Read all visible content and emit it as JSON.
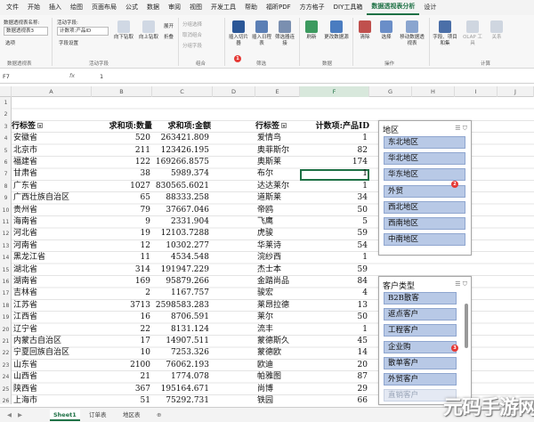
{
  "menubar": {
    "items": [
      "文件",
      "开始",
      "插入",
      "绘图",
      "页面布局",
      "公式",
      "数据",
      "审阅",
      "视图",
      "开发工具",
      "帮助",
      "福昕PDF",
      "方方格子",
      "DIY工具箱",
      "数据透视表分析",
      "设计"
    ],
    "active_index": 14
  },
  "ribbon": {
    "pivot_name_label": "数据透视表名称:",
    "pivot_name": "数据透视表3",
    "options_label": "选项",
    "active_field_label": "活动字段:",
    "active_field": "计数项:产品ID",
    "field_settings": "字段设置",
    "drill_down": "向下钻取",
    "drill_up": "向上钻取",
    "expand": "展开",
    "collapse": "折叠",
    "group_selection": "分组选择",
    "ungroup": "取消组合",
    "group_field": "分组字段",
    "insert_slicer": "插入切片器",
    "insert_timeline": "插入日程表",
    "filter_connections": "筛选器连接",
    "refresh": "刷新",
    "change_source": "更改数据源",
    "clear": "清除",
    "select": "选择",
    "move_pivot": "移动数据透视表",
    "fields_items_sets": "字段、项目和集",
    "olap_tools": "OLAP 工具",
    "relationships": "关系",
    "groups": {
      "pivot": "数据透视表",
      "active_field": "活动字段",
      "combine": "组合",
      "filter": "筛选",
      "data": "数据",
      "actions": "操作",
      "calc": "计算"
    }
  },
  "formula_bar": {
    "name_box": "F7",
    "fx": "fx",
    "value": "1"
  },
  "columns": [
    "A",
    "B",
    "C",
    "D",
    "E",
    "F",
    "G",
    "H",
    "I",
    "J"
  ],
  "selected_column": "F",
  "rows": [
    "1",
    "2",
    "3",
    "4",
    "5",
    "6",
    "7",
    "8",
    "9",
    "10",
    "11",
    "12",
    "13",
    "14",
    "15",
    "16",
    "17",
    "18",
    "19",
    "20",
    "21",
    "22",
    "23",
    "24",
    "25",
    "26",
    "27"
  ],
  "left_table": {
    "headers": [
      "行标签",
      "求和项:数量",
      "求和项:金额"
    ],
    "rows": [
      [
        "安徽省",
        "520",
        "263421.809"
      ],
      [
        "北京市",
        "211",
        "123426.195"
      ],
      [
        "福建省",
        "122",
        "169266.8575"
      ],
      [
        "甘肃省",
        "38",
        "5989.374"
      ],
      [
        "广东省",
        "1027",
        "830565.6021"
      ],
      [
        "广西壮族自治区",
        "65",
        "88333.258"
      ],
      [
        "贵州省",
        "79",
        "37667.046"
      ],
      [
        "海南省",
        "9",
        "2331.904"
      ],
      [
        "河北省",
        "19",
        "12103.7288"
      ],
      [
        "河南省",
        "12",
        "10302.277"
      ],
      [
        "黑龙江省",
        "11",
        "4534.548"
      ],
      [
        "湖北省",
        "314",
        "191947.229"
      ],
      [
        "湖南省",
        "169",
        "95879.266"
      ],
      [
        "吉林省",
        "2",
        "1167.757"
      ],
      [
        "江苏省",
        "3713",
        "2598583.283"
      ],
      [
        "江西省",
        "16",
        "8706.591"
      ],
      [
        "辽宁省",
        "22",
        "8131.124"
      ],
      [
        "内蒙古自治区",
        "17",
        "14907.511"
      ],
      [
        "宁夏回族自治区",
        "10",
        "7253.326"
      ],
      [
        "山东省",
        "2100",
        "76062.193"
      ],
      [
        "山西省",
        "21",
        "1774.078"
      ],
      [
        "陕西省",
        "367",
        "195164.671"
      ],
      [
        "上海市",
        "51",
        "75292.731"
      ]
    ]
  },
  "right_table": {
    "headers": [
      "行标签",
      "计数项:产品ID"
    ],
    "rows": [
      [
        "爱情鸟",
        "1"
      ],
      [
        "奥菲斯尔",
        "82"
      ],
      [
        "奥斯莱",
        "174"
      ],
      [
        "布尔",
        "1"
      ],
      [
        "达达莱尔",
        "1"
      ],
      [
        "道斯莱",
        "34"
      ],
      [
        "帝鸥",
        "50"
      ],
      [
        "飞鹰",
        "5"
      ],
      [
        "虎骏",
        "59"
      ],
      [
        "华莱诗",
        "54"
      ],
      [
        "浣纱西",
        "1"
      ],
      [
        "杰士本",
        "59"
      ],
      [
        "金踏尚品",
        "84"
      ],
      [
        "骏宏",
        "4"
      ],
      [
        "莱昂拉德",
        "13"
      ],
      [
        "莱尔",
        "50"
      ],
      [
        "流丰",
        "1"
      ],
      [
        "蒙德斯久",
        "45"
      ],
      [
        "蒙德欧",
        "14"
      ],
      [
        "欧迪",
        "20"
      ],
      [
        "帕雅图",
        "87"
      ],
      [
        "尚博",
        "29"
      ],
      [
        "铁园",
        "66"
      ]
    ]
  },
  "slicer_region": {
    "title": "地区",
    "items": [
      "东北地区",
      "华北地区",
      "华东地区",
      "外贸",
      "西北地区",
      "西南地区",
      "中南地区"
    ],
    "badge": "2"
  },
  "slicer_customer": {
    "title": "客户类型",
    "items": [
      "B2B散客",
      "返点客户",
      "工程客户",
      "企业购",
      "散单客户",
      "外贸客户",
      "直销客户"
    ],
    "badge": "3"
  },
  "ribbon_badge": "1",
  "sheet_tabs": [
    "Sheet1",
    "订单表",
    "地区表"
  ],
  "active_sheet": "Sheet1",
  "watermark": "元码手游网"
}
